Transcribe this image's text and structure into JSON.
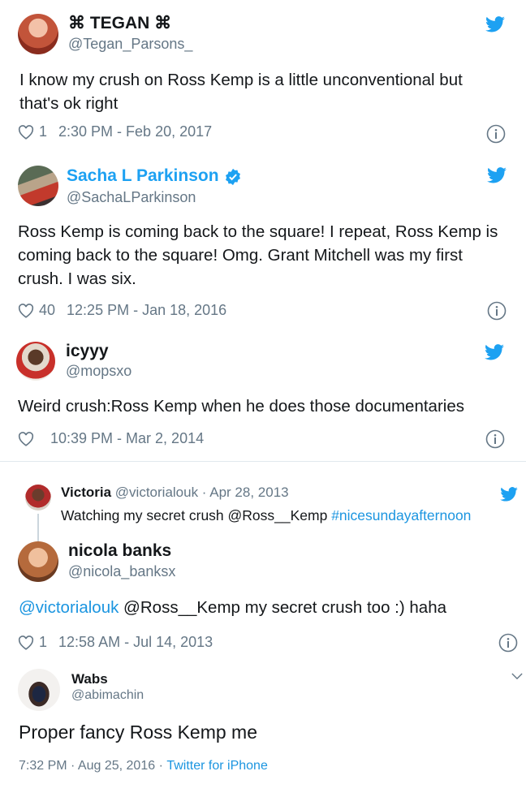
{
  "tweets": [
    {
      "name": "⌘ TEGAN ⌘",
      "handle": "@Tegan_Parsons_",
      "text": "I know my crush on Ross Kemp is a little unconventional but that's ok right",
      "likes": "1",
      "timestamp": "2:30 PM - Feb 20, 2017"
    },
    {
      "name": "Sacha L Parkinson",
      "handle": "@SachaLParkinson",
      "text": "Ross Kemp is coming back to the square! I repeat, Ross Kemp is coming back to the square! Omg. Grant Mitchell was my first crush. I was six.",
      "likes": "40",
      "timestamp": "12:25 PM - Jan 18, 2016"
    },
    {
      "name": "icyyy",
      "handle": "@mopsxo",
      "text": "Weird crush:Ross Kemp when he does those documentaries",
      "likes": "",
      "timestamp": "10:39 PM - Mar 2, 2014"
    },
    {
      "parent": {
        "name": "Victoria",
        "handle_date": "@victorialouk · Apr 28, 2013",
        "text_plain": "Watching my secret crush @Ross__Kemp ",
        "hashtag": "#nicesundayafternoon"
      },
      "name": "nicola banks",
      "handle": "@nicola_banksx",
      "mention": "@victorialouk",
      "text_rest": " @Ross__Kemp  my secret crush too :) haha",
      "likes": "1",
      "timestamp": "12:58 AM - Jul 14, 2013"
    },
    {
      "name": "Wabs",
      "handle": "@abimachin",
      "text": "Proper fancy Ross Kemp me",
      "time_date": "7:32 PM · Aug 25, 2016 · ",
      "source": "Twitter for iPhone"
    }
  ],
  "colors": {
    "twitter_blue": "#1da1f2",
    "link": "#1b95e0",
    "secondary": "#657786",
    "verified": "#1da1f2"
  }
}
